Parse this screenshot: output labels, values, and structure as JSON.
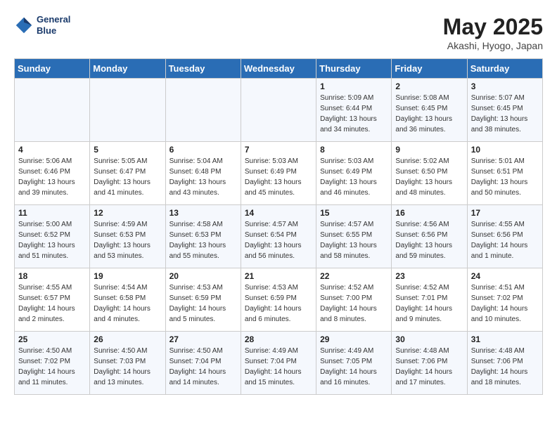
{
  "header": {
    "logo_line1": "General",
    "logo_line2": "Blue",
    "month_year": "May 2025",
    "location": "Akashi, Hyogo, Japan"
  },
  "days_of_week": [
    "Sunday",
    "Monday",
    "Tuesday",
    "Wednesday",
    "Thursday",
    "Friday",
    "Saturday"
  ],
  "weeks": [
    [
      {
        "num": "",
        "detail": ""
      },
      {
        "num": "",
        "detail": ""
      },
      {
        "num": "",
        "detail": ""
      },
      {
        "num": "",
        "detail": ""
      },
      {
        "num": "1",
        "detail": "Sunrise: 5:09 AM\nSunset: 6:44 PM\nDaylight: 13 hours\nand 34 minutes."
      },
      {
        "num": "2",
        "detail": "Sunrise: 5:08 AM\nSunset: 6:45 PM\nDaylight: 13 hours\nand 36 minutes."
      },
      {
        "num": "3",
        "detail": "Sunrise: 5:07 AM\nSunset: 6:45 PM\nDaylight: 13 hours\nand 38 minutes."
      }
    ],
    [
      {
        "num": "4",
        "detail": "Sunrise: 5:06 AM\nSunset: 6:46 PM\nDaylight: 13 hours\nand 39 minutes."
      },
      {
        "num": "5",
        "detail": "Sunrise: 5:05 AM\nSunset: 6:47 PM\nDaylight: 13 hours\nand 41 minutes."
      },
      {
        "num": "6",
        "detail": "Sunrise: 5:04 AM\nSunset: 6:48 PM\nDaylight: 13 hours\nand 43 minutes."
      },
      {
        "num": "7",
        "detail": "Sunrise: 5:03 AM\nSunset: 6:49 PM\nDaylight: 13 hours\nand 45 minutes."
      },
      {
        "num": "8",
        "detail": "Sunrise: 5:03 AM\nSunset: 6:49 PM\nDaylight: 13 hours\nand 46 minutes."
      },
      {
        "num": "9",
        "detail": "Sunrise: 5:02 AM\nSunset: 6:50 PM\nDaylight: 13 hours\nand 48 minutes."
      },
      {
        "num": "10",
        "detail": "Sunrise: 5:01 AM\nSunset: 6:51 PM\nDaylight: 13 hours\nand 50 minutes."
      }
    ],
    [
      {
        "num": "11",
        "detail": "Sunrise: 5:00 AM\nSunset: 6:52 PM\nDaylight: 13 hours\nand 51 minutes."
      },
      {
        "num": "12",
        "detail": "Sunrise: 4:59 AM\nSunset: 6:53 PM\nDaylight: 13 hours\nand 53 minutes."
      },
      {
        "num": "13",
        "detail": "Sunrise: 4:58 AM\nSunset: 6:53 PM\nDaylight: 13 hours\nand 55 minutes."
      },
      {
        "num": "14",
        "detail": "Sunrise: 4:57 AM\nSunset: 6:54 PM\nDaylight: 13 hours\nand 56 minutes."
      },
      {
        "num": "15",
        "detail": "Sunrise: 4:57 AM\nSunset: 6:55 PM\nDaylight: 13 hours\nand 58 minutes."
      },
      {
        "num": "16",
        "detail": "Sunrise: 4:56 AM\nSunset: 6:56 PM\nDaylight: 13 hours\nand 59 minutes."
      },
      {
        "num": "17",
        "detail": "Sunrise: 4:55 AM\nSunset: 6:56 PM\nDaylight: 14 hours\nand 1 minute."
      }
    ],
    [
      {
        "num": "18",
        "detail": "Sunrise: 4:55 AM\nSunset: 6:57 PM\nDaylight: 14 hours\nand 2 minutes."
      },
      {
        "num": "19",
        "detail": "Sunrise: 4:54 AM\nSunset: 6:58 PM\nDaylight: 14 hours\nand 4 minutes."
      },
      {
        "num": "20",
        "detail": "Sunrise: 4:53 AM\nSunset: 6:59 PM\nDaylight: 14 hours\nand 5 minutes."
      },
      {
        "num": "21",
        "detail": "Sunrise: 4:53 AM\nSunset: 6:59 PM\nDaylight: 14 hours\nand 6 minutes."
      },
      {
        "num": "22",
        "detail": "Sunrise: 4:52 AM\nSunset: 7:00 PM\nDaylight: 14 hours\nand 8 minutes."
      },
      {
        "num": "23",
        "detail": "Sunrise: 4:52 AM\nSunset: 7:01 PM\nDaylight: 14 hours\nand 9 minutes."
      },
      {
        "num": "24",
        "detail": "Sunrise: 4:51 AM\nSunset: 7:02 PM\nDaylight: 14 hours\nand 10 minutes."
      }
    ],
    [
      {
        "num": "25",
        "detail": "Sunrise: 4:50 AM\nSunset: 7:02 PM\nDaylight: 14 hours\nand 11 minutes."
      },
      {
        "num": "26",
        "detail": "Sunrise: 4:50 AM\nSunset: 7:03 PM\nDaylight: 14 hours\nand 13 minutes."
      },
      {
        "num": "27",
        "detail": "Sunrise: 4:50 AM\nSunset: 7:04 PM\nDaylight: 14 hours\nand 14 minutes."
      },
      {
        "num": "28",
        "detail": "Sunrise: 4:49 AM\nSunset: 7:04 PM\nDaylight: 14 hours\nand 15 minutes."
      },
      {
        "num": "29",
        "detail": "Sunrise: 4:49 AM\nSunset: 7:05 PM\nDaylight: 14 hours\nand 16 minutes."
      },
      {
        "num": "30",
        "detail": "Sunrise: 4:48 AM\nSunset: 7:06 PM\nDaylight: 14 hours\nand 17 minutes."
      },
      {
        "num": "31",
        "detail": "Sunrise: 4:48 AM\nSunset: 7:06 PM\nDaylight: 14 hours\nand 18 minutes."
      }
    ]
  ]
}
